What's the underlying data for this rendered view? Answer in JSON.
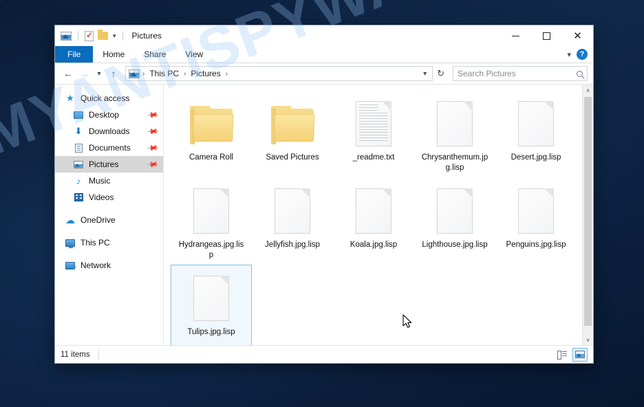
{
  "desktop": {
    "watermark": "MYANTISPYWARE.COM",
    "bg_color": "#0d2340"
  },
  "window": {
    "title": "Pictures",
    "quick_access": [
      {
        "name": "pictures-library-icon",
        "label": "Pictures library"
      },
      {
        "name": "properties-icon",
        "label": "Properties"
      },
      {
        "name": "new-folder-icon",
        "label": "New folder"
      },
      {
        "name": "customize-caret-icon",
        "label": "Customize Quick Access Toolbar"
      }
    ],
    "controls": {
      "minimize": "─",
      "maximize": "□",
      "close": "✕"
    },
    "ribbon_expand": "∨",
    "help": "?"
  },
  "ribbon": {
    "tabs": [
      {
        "label": "File",
        "active": true
      },
      {
        "label": "Home",
        "active": false
      },
      {
        "label": "Share",
        "active": false
      },
      {
        "label": "View",
        "active": false
      }
    ]
  },
  "navigation": {
    "back": "←",
    "forward": "→",
    "recent": "⌄",
    "up": "↑",
    "breadcrumbs": [
      "This PC",
      "Pictures"
    ],
    "breadcrumb_sep": "›",
    "dropdown": "∨",
    "refresh": "↻"
  },
  "search": {
    "placeholder": "Search Pictures",
    "value": ""
  },
  "sidebar": {
    "items": [
      {
        "label": "Quick access",
        "icon": "star-icon",
        "indent": false,
        "pinned": false,
        "selected": false
      },
      {
        "label": "Desktop",
        "icon": "desktop-icon",
        "indent": true,
        "pinned": true,
        "selected": false
      },
      {
        "label": "Downloads",
        "icon": "download-icon",
        "indent": true,
        "pinned": true,
        "selected": false
      },
      {
        "label": "Documents",
        "icon": "documents-icon",
        "indent": true,
        "pinned": true,
        "selected": false
      },
      {
        "label": "Pictures",
        "icon": "pictures-icon",
        "indent": true,
        "pinned": true,
        "selected": true
      },
      {
        "label": "Music",
        "icon": "music-icon",
        "indent": true,
        "pinned": false,
        "selected": false
      },
      {
        "label": "Videos",
        "icon": "video-icon",
        "indent": true,
        "pinned": false,
        "selected": false
      },
      {
        "label": "OneDrive",
        "icon": "cloud-icon",
        "indent": false,
        "pinned": false,
        "selected": false,
        "gap_before": true
      },
      {
        "label": "This PC",
        "icon": "computer-icon",
        "indent": false,
        "pinned": false,
        "selected": false,
        "gap_before": true
      },
      {
        "label": "Network",
        "icon": "network-icon",
        "indent": false,
        "pinned": false,
        "selected": false,
        "gap_before": true
      }
    ],
    "pin_glyph": "📌"
  },
  "files": [
    {
      "name": "Camera Roll",
      "type": "folder",
      "selected": false
    },
    {
      "name": "Saved Pictures",
      "type": "folder",
      "selected": false
    },
    {
      "name": "_readme.txt",
      "type": "text",
      "selected": false
    },
    {
      "name": "Chrysanthemum.jpg.lisp",
      "type": "blank",
      "selected": false
    },
    {
      "name": "Desert.jpg.lisp",
      "type": "blank",
      "selected": false
    },
    {
      "name": "Hydrangeas.jpg.lisp",
      "type": "blank",
      "selected": false
    },
    {
      "name": "Jellyfish.jpg.lisp",
      "type": "blank",
      "selected": false
    },
    {
      "name": "Koala.jpg.lisp",
      "type": "blank",
      "selected": false
    },
    {
      "name": "Lighthouse.jpg.lisp",
      "type": "blank",
      "selected": false
    },
    {
      "name": "Penguins.jpg.lisp",
      "type": "blank",
      "selected": false
    },
    {
      "name": "Tulips.jpg.lisp",
      "type": "blank",
      "selected": true
    }
  ],
  "statusbar": {
    "item_count": "11 items",
    "views": [
      {
        "name": "details-view-button",
        "active": false
      },
      {
        "name": "large-icons-view-button",
        "active": true
      }
    ]
  },
  "scrollbar": {
    "up_arrow": "∧",
    "down_arrow": "∨"
  }
}
